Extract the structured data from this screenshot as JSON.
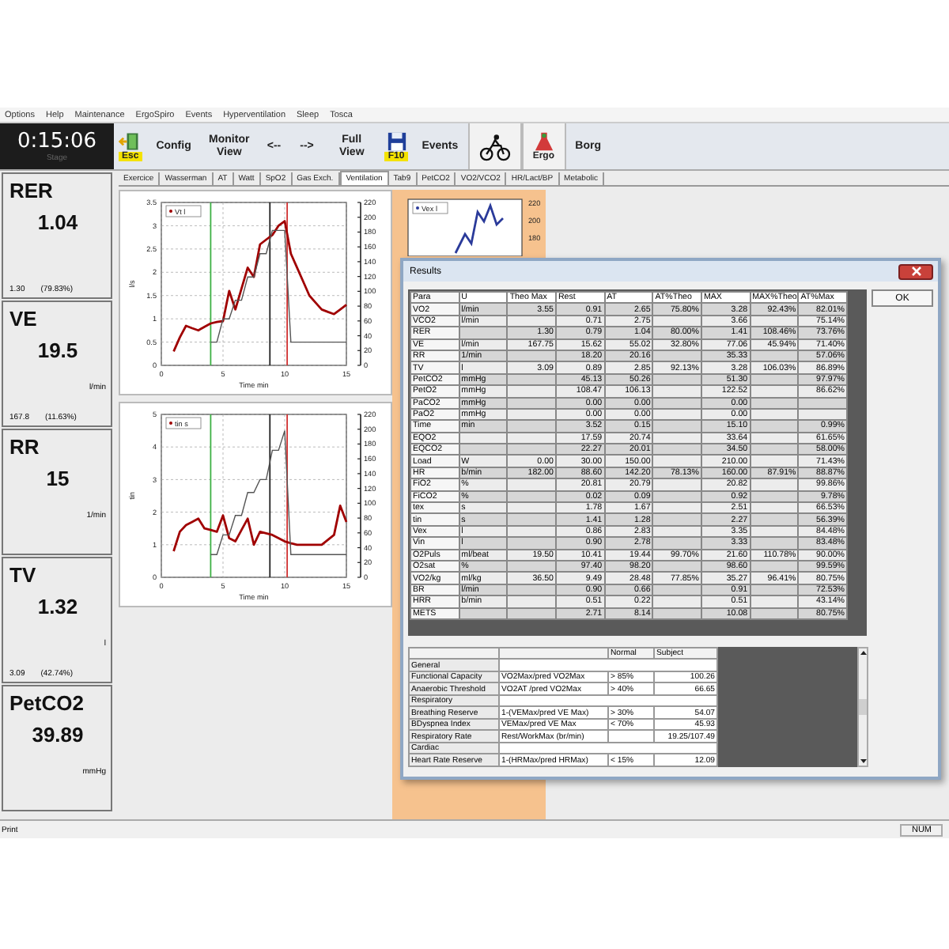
{
  "menu": [
    "Options",
    "Help",
    "Maintenance",
    "ErgoSpiro",
    "Events",
    "Hyperventilation",
    "Sleep",
    "Tosca"
  ],
  "timer": {
    "time": "0:15:06",
    "caption": "Stage"
  },
  "toolbar": [
    {
      "kind": "exit",
      "label": "Esc"
    },
    {
      "kind": "text",
      "label": "Config"
    },
    {
      "kind": "text",
      "label": "Monitor View"
    },
    {
      "kind": "text",
      "label": "<--"
    },
    {
      "kind": "text",
      "label": "-->"
    },
    {
      "kind": "text",
      "label": "Full View"
    },
    {
      "kind": "save",
      "label": "F10"
    },
    {
      "kind": "text",
      "label": "Events"
    },
    {
      "kind": "bike"
    },
    {
      "kind": "ergo",
      "label": "Ergo"
    },
    {
      "kind": "text",
      "label": "Borg"
    }
  ],
  "monitors": [
    {
      "name": "RER",
      "value": "1.04",
      "ref": "1.30",
      "percent": "(79.83%)"
    },
    {
      "name": "VE",
      "value": "19.5",
      "unit": "l/min",
      "ref": "167.8",
      "percent": "(11.63%)"
    },
    {
      "name": "RR",
      "value": "15",
      "unit": "1/min"
    },
    {
      "name": "TV",
      "value": "1.32",
      "unit": "l",
      "ref": "3.09",
      "percent": "(42.74%)"
    },
    {
      "name": "PetCO2",
      "value": "39.89",
      "unit": "mmHg"
    }
  ],
  "tabs": [
    {
      "label": "Exercice",
      "selected": false
    },
    {
      "label": "Wasserman",
      "selected": false
    },
    {
      "label": "AT",
      "selected": false
    },
    {
      "label": "Watt",
      "selected": false
    },
    {
      "label": "SpO2",
      "selected": false
    },
    {
      "label": "Gas Exch.",
      "selected": false
    },
    {
      "label": "Ventilation",
      "selected": true
    },
    {
      "label": "Tab9",
      "selected": false
    },
    {
      "label": "PetCO2",
      "selected": false
    },
    {
      "label": "VO2/VCO2",
      "selected": false
    },
    {
      "label": "HR/Lact/BP",
      "selected": false
    },
    {
      "label": "Metabolic",
      "selected": false
    }
  ],
  "charts": [
    {
      "y2_ticks": [
        "220",
        "200",
        "180",
        "160",
        "140",
        "120",
        "100",
        "80",
        "60",
        "40",
        "20",
        "0"
      ],
      "chart_data": {
        "type": "line",
        "grid": true,
        "ref_lines": [
          {
            "axis": "x",
            "value": 4,
            "color": "#3cb043"
          },
          {
            "axis": "x",
            "value": 8.8,
            "color": "#222222"
          },
          {
            "axis": "x",
            "value": 10.2,
            "color": "#d03030"
          }
        ],
        "xlabel": "Time min",
        "ylabel": "l/s",
        "xlim": [
          0,
          15
        ],
        "ylim": [
          0,
          3.5
        ],
        "xticks": [
          0,
          5,
          10,
          15
        ],
        "yticks": [
          0,
          0.5,
          1,
          1.5,
          2,
          2.5,
          3,
          3.5
        ],
        "x": [
          1,
          1.5,
          2,
          2.5,
          3,
          3.5,
          4,
          4.5,
          5,
          5.5,
          6,
          6.5,
          7,
          7.5,
          8,
          8.5,
          9,
          9.5,
          10,
          10.5,
          11,
          11.5,
          12,
          12.5,
          13,
          13.5,
          14,
          14.5,
          15
        ],
        "series": [
          {
            "name": "Vt l",
            "color": "#a00000",
            "values": [
              0.3,
              0.6,
              0.85,
              0.8,
              0.75,
              0.83,
              0.9,
              0.93,
              0.95,
              1.6,
              1.2,
              1.65,
              2.1,
              1.9,
              2.6,
              2.7,
              2.8,
              3.0,
              3.1,
              2.4,
              2.1,
              1.8,
              1.5,
              1.35,
              1.2,
              1.15,
              1.1,
              1.2,
              1.3
            ]
          },
          {
            "color": "#555555",
            "values": [
              null,
              null,
              null,
              null,
              null,
              null,
              0.5,
              0.5,
              1,
              1,
              1.4,
              1.4,
              1.9,
              1.9,
              2.4,
              2.4,
              2.9,
              2.9,
              2.9,
              0.5,
              0.5,
              0.5,
              0.5,
              0.5,
              0.5,
              0.5,
              0.5,
              0.5,
              0.5
            ]
          }
        ]
      }
    },
    {
      "y2_ticks": [
        "220",
        "200",
        "180",
        "160",
        "140",
        "120",
        "100",
        "80",
        "60",
        "40",
        "20",
        "0"
      ],
      "chart_data": {
        "type": "line",
        "grid": true,
        "ref_lines": [
          {
            "axis": "x",
            "value": 4,
            "color": "#3cb043"
          },
          {
            "axis": "x",
            "value": 8.8,
            "color": "#222222"
          },
          {
            "axis": "x",
            "value": 10.2,
            "color": "#d03030"
          }
        ],
        "xlabel": "Time min",
        "ylabel": "tin",
        "xlim": [
          0,
          15
        ],
        "ylim": [
          0,
          5
        ],
        "xticks": [
          0,
          5,
          10,
          15
        ],
        "yticks": [
          0,
          1,
          2,
          3,
          4,
          5
        ],
        "x": [
          1,
          1.5,
          2,
          2.5,
          3,
          3.5,
          4,
          4.5,
          5,
          5.5,
          6,
          6.5,
          7,
          7.5,
          8,
          8.5,
          9,
          9.5,
          10,
          10.5,
          11,
          11.5,
          12,
          12.5,
          13,
          13.5,
          14,
          14.5,
          15
        ],
        "series": [
          {
            "name": "tin s",
            "color": "#a00000",
            "values": [
              0.8,
              1.4,
              1.6,
              1.7,
              1.8,
              1.5,
              1.45,
              1.4,
              1.9,
              1.2,
              1.1,
              1.45,
              1.8,
              1.0,
              1.4,
              1.35,
              1.3,
              1.2,
              1.1,
              1.05,
              1.0,
              1.0,
              1.0,
              1.0,
              1.0,
              1.15,
              1.3,
              2.2,
              1.7
            ]
          },
          {
            "color": "#555555",
            "values": [
              null,
              null,
              null,
              null,
              null,
              null,
              0.7,
              0.7,
              1.3,
              1.3,
              1.9,
              1.9,
              2.6,
              2.6,
              3.0,
              3.0,
              3.9,
              3.9,
              4.5,
              0.7,
              0.7,
              0.7,
              0.7,
              0.7,
              0.7,
              0.7,
              0.7,
              0.7,
              0.7
            ]
          }
        ]
      }
    }
  ],
  "side_chart": {
    "legend": "Vex l",
    "y2_ticks": [
      "220",
      "200",
      "180"
    ]
  },
  "results": {
    "title": "Results",
    "ok": "OK",
    "columns": [
      "Para",
      "U",
      "Theo Max",
      "Rest",
      "AT",
      "AT%Theo",
      "MAX",
      "MAX%Theo",
      "AT%Max"
    ],
    "rows": [
      [
        "VO2",
        "l/min",
        "3.55",
        "0.91",
        "2.65",
        "75.80%",
        "3.28",
        "92.43%",
        "82.01%"
      ],
      [
        "VCO2",
        "l/min",
        null,
        "0.71",
        "2.75",
        null,
        "3.66",
        null,
        "75.14%"
      ],
      [
        "RER",
        null,
        "1.30",
        "0.79",
        "1.04",
        "80.00%",
        "1.41",
        "108.46%",
        "73.76%"
      ],
      [
        "VE",
        "l/min",
        "167.75",
        "15.62",
        "55.02",
        "32.80%",
        "77.06",
        "45.94%",
        "71.40%"
      ],
      [
        "RR",
        "1/min",
        null,
        "18.20",
        "20.16",
        null,
        "35.33",
        null,
        "57.06%"
      ],
      [
        "TV",
        "l",
        "3.09",
        "0.89",
        "2.85",
        "92.13%",
        "3.28",
        "106.03%",
        "86.89%"
      ],
      [
        "PetCO2",
        "mmHg",
        null,
        "45.13",
        "50.26",
        null,
        "51.30",
        null,
        "97.97%"
      ],
      [
        "PetO2",
        "mmHg",
        null,
        "108.47",
        "106.13",
        null,
        "122.52",
        null,
        "86.62%"
      ],
      [
        "PaCO2",
        "mmHg",
        null,
        "0.00",
        "0.00",
        null,
        "0.00",
        null,
        null
      ],
      [
        "PaO2",
        "mmHg",
        null,
        "0.00",
        "0.00",
        null,
        "0.00",
        null,
        null
      ],
      [
        "Time",
        "min",
        null,
        "3.52",
        "0.15",
        null,
        "15.10",
        null,
        "0.99%"
      ],
      [
        "EQO2",
        null,
        null,
        "17.59",
        "20.74",
        null,
        "33.64",
        null,
        "61.65%"
      ],
      [
        "EQCO2",
        null,
        null,
        "22.27",
        "20.01",
        null,
        "34.50",
        null,
        "58.00%"
      ],
      [
        "Load",
        "W",
        "0.00",
        "30.00",
        "150.00",
        null,
        "210.00",
        null,
        "71.43%"
      ],
      [
        "HR",
        "b/min",
        "182.00",
        "88.60",
        "142.20",
        "78.13%",
        "160.00",
        "87.91%",
        "88.87%"
      ],
      [
        "FiO2",
        "%",
        null,
        "20.81",
        "20.79",
        null,
        "20.82",
        null,
        "99.86%"
      ],
      [
        "FiCO2",
        "%",
        null,
        "0.02",
        "0.09",
        null,
        "0.92",
        null,
        "9.78%"
      ],
      [
        "tex",
        "s",
        null,
        "1.78",
        "1.67",
        null,
        "2.51",
        null,
        "66.53%"
      ],
      [
        "tin",
        "s",
        null,
        "1.41",
        "1.28",
        null,
        "2.27",
        null,
        "56.39%"
      ],
      [
        "Vex",
        "l",
        null,
        "0.86",
        "2.83",
        null,
        "3.35",
        null,
        "84.48%"
      ],
      [
        "Vin",
        "l",
        null,
        "0.90",
        "2.78",
        null,
        "3.33",
        null,
        "83.48%"
      ],
      [
        "O2Puls",
        "ml/beat",
        "19.50",
        "10.41",
        "19.44",
        "99.70%",
        "21.60",
        "110.78%",
        "90.00%"
      ],
      [
        "O2sat",
        "%",
        null,
        "97.40",
        "98.20",
        null,
        "98.60",
        null,
        "99.59%"
      ],
      [
        "VO2/kg",
        "ml/kg",
        "36.50",
        "9.49",
        "28.48",
        "77.85%",
        "35.27",
        "96.41%",
        "80.75%"
      ],
      [
        "BR",
        "l/min",
        null,
        "0.90",
        "0.66",
        null,
        "0.91",
        null,
        "72.53%"
      ],
      [
        "HRR",
        "b/min",
        null,
        "0.51",
        "0.22",
        null,
        "0.51",
        null,
        "43.14%"
      ],
      [
        "METS",
        null,
        null,
        "2.71",
        "8.14",
        null,
        "10.08",
        null,
        "80.75%"
      ]
    ],
    "summary": {
      "columns": [
        "",
        "",
        "Normal",
        "Subject"
      ],
      "rows": [
        {
          "kind": "section",
          "cells": [
            "General"
          ]
        },
        {
          "kind": "item",
          "cells": [
            "Functional Capacity",
            "VO2Max/pred VO2Max",
            "> 85%",
            "100.26"
          ]
        },
        {
          "kind": "item",
          "cells": [
            "Anaerobic Threshold",
            "VO2AT /pred VO2Max",
            "> 40%",
            "66.65"
          ]
        },
        {
          "kind": "section",
          "cells": [
            "Respiratory"
          ]
        },
        {
          "kind": "item",
          "cells": [
            "Breathing Reserve",
            "1-(VEMax/pred VE Max)",
            "> 30%",
            "54.07"
          ]
        },
        {
          "kind": "item",
          "cells": [
            "BDyspnea Index",
            "VEMax/pred VE Max",
            "< 70%",
            "45.93"
          ]
        },
        {
          "kind": "item",
          "cells": [
            "Respiratory Rate",
            "Rest/WorkMax (br/min)",
            "",
            "19.25/107.49"
          ]
        },
        {
          "kind": "section",
          "cells": [
            "Cardiac"
          ]
        },
        {
          "kind": "item",
          "cells": [
            "Heart Rate Reserve",
            "1-(HRMax/pred HRMax)",
            "< 15%",
            "12.09"
          ]
        }
      ]
    }
  },
  "status_bar": {
    "left": "Print",
    "right": "NUM"
  }
}
